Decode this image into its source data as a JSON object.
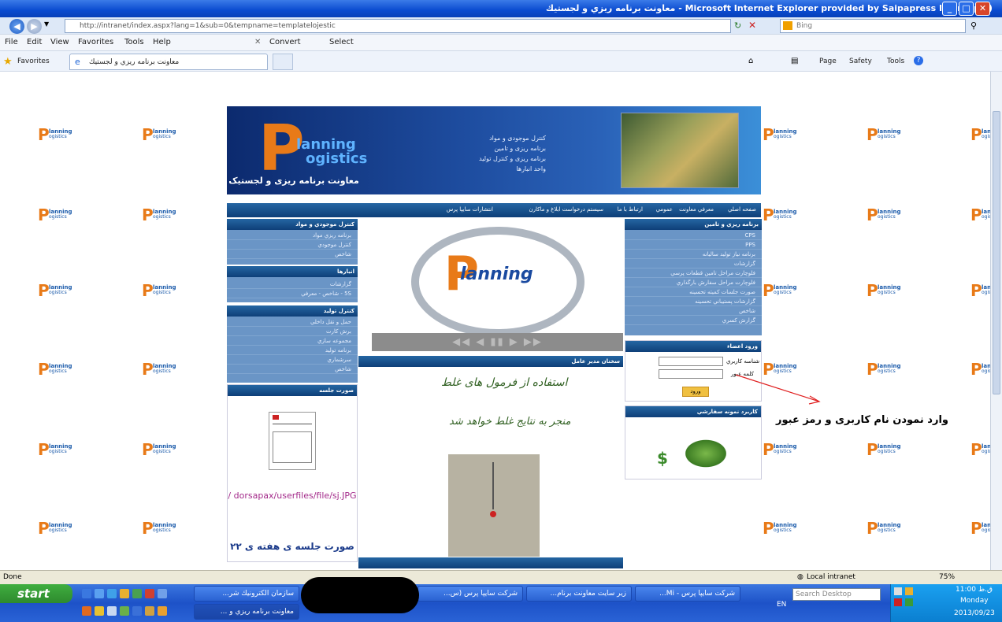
{
  "window": {
    "title": "معاونت برنامه ريزي و لجستيك - Microsoft Internet Explorer provided by Saipapress IT group",
    "buttons": [
      "_",
      "□",
      "✕"
    ]
  },
  "addressbar": {
    "url": "http://intranet/index.aspx?lang=1&sub=0&tempname=templatelojestic",
    "search_placeholder": "Bing"
  },
  "menubar": {
    "items": [
      "File",
      "Edit",
      "View",
      "Favorites",
      "Tools",
      "Help"
    ],
    "convert": "Convert",
    "select": "Select"
  },
  "favbar": {
    "favorites": "Favorites",
    "tab": "معاونت برنامه ريزي و لجستيك",
    "tools": [
      "Page",
      "Safety",
      "Tools"
    ]
  },
  "banner": {
    "logo_line1": "lanning",
    "logo_line2": "ogistics",
    "subtitle": "معاونت برنامه ریزی و لجستیک",
    "lines": [
      "کنترل موجودی و مواد",
      "برنامه ریزی و تامین",
      "برنامه ریزی و کنترل تولید",
      "واحد انبارها"
    ]
  },
  "nav": {
    "items": [
      "صفحه اصلي",
      "معرفي معاونت",
      "عمومي",
      "ارتباط با ما",
      "سیستم درخواست ابلاغ و ماکارن",
      "انتشارات سایپا پرس"
    ]
  },
  "left": {
    "panel1": {
      "title": "كنترل موجودي و مواد",
      "items": [
        "برنامه ريزي مواد",
        "كنترل موجودي",
        "شاخص"
      ]
    },
    "panel2": {
      "title": "انبارها",
      "items": [
        "گزارشات",
        "5S - شاخص - معرفي"
      ]
    },
    "panel3": {
      "title": "كنترل توليد",
      "items": [
        "حمل و نقل داخلي",
        "برش كارت",
        "مجموعه سازي",
        "برنامه توليد",
        "سرشماري",
        "شاخص"
      ]
    },
    "panel4": {
      "title": "صورت جلسه"
    },
    "caption_link": "/ dorsapax/userfiles/file/sj.JPG",
    "caption": "صورت جلسه ی هفته ی ۲۲"
  },
  "center": {
    "slider_logo": "lanning",
    "controls": "◀◀ ◀ ▮▮ ▶ ▶▶",
    "news_title": "سخنان مدیر عامل",
    "quote1": "استفاده از فرمول های غلط",
    "quote2": "منجر به نتایج غلط خواهد شد"
  },
  "right": {
    "panel1": {
      "title": "برنامه ريزي و تامين",
      "items": [
        "CPS",
        "PPS",
        "برنامه نياز توليد ساليانه",
        "گزارشات",
        "فلوچارت مراحل تامين قطعات پرسي",
        "فلوچارت مراحل سفارش بارگذاري",
        "صورت جلسات كميته تحسينه",
        "گزارشات پستيباني تحسينه",
        "شاخص",
        "گزارش كسري"
      ]
    },
    "login": {
      "title": "ورود اعضاء",
      "username_label": "شناسه كاربري",
      "password_label": "كلمه عبور",
      "submit": "ورود"
    },
    "panel3": {
      "title": "كاربرد نمونه سفارشي"
    }
  },
  "annotation": "وارد نمودن نام کاربری و رمز عبور",
  "statusbar": {
    "left": "Done",
    "zone": "Local intranet",
    "zoom": "75%"
  },
  "taskbar": {
    "start": "start",
    "tasks_top": [
      "سازمان الكترونيك شر...",
      "شركت سايپا پرس (س...",
      "زير سايت معاونت برنام...",
      "شركت سايپا پرس - Mi..."
    ],
    "tasks_bottom": [
      "معاونت برنامه ريزي و ..."
    ],
    "lang": "EN",
    "search": "Search Desktop",
    "time": "11:00 ق.ظ",
    "day": "Monday",
    "date": "2013/09/23"
  },
  "colors": {
    "titlebar": "#0a4bd0",
    "nav": "#0e3f78",
    "panel": "#6a95c6",
    "logo_orange": "#e87a18",
    "taskbar": "#245edb",
    "start": "#3a9a3a"
  }
}
